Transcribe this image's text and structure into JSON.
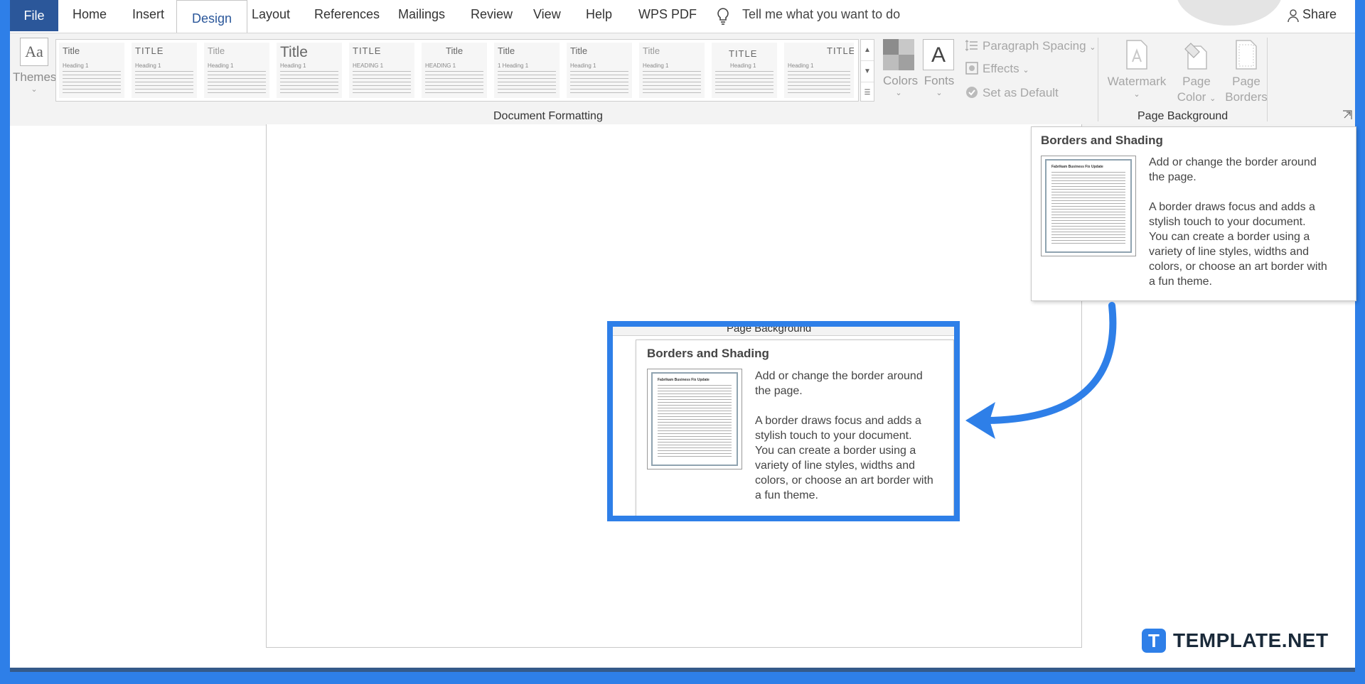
{
  "tabs": {
    "file": "File",
    "home": "Home",
    "insert": "Insert",
    "design": "Design",
    "layout": "Layout",
    "references": "References",
    "mailings": "Mailings",
    "review": "Review",
    "view": "View",
    "help": "Help",
    "wps_pdf": "WPS PDF"
  },
  "tell_me": "Tell me what you want to do",
  "share": "Share",
  "ribbon": {
    "themes_label": "Themes",
    "style_gallery": [
      {
        "title": "Title",
        "heading": "Heading 1"
      },
      {
        "title": "TITLE",
        "heading": "Heading 1"
      },
      {
        "title": "Title",
        "heading": "Heading 1"
      },
      {
        "title": "Title",
        "heading": "Heading 1"
      },
      {
        "title": "TITLE",
        "heading": "HEADING 1"
      },
      {
        "title": "Title",
        "heading": "HEADING 1"
      },
      {
        "title": "Title",
        "heading": "1   Heading 1"
      },
      {
        "title": "Title",
        "heading": "Heading 1"
      },
      {
        "title": "Title",
        "heading": "Heading 1"
      },
      {
        "title": "TITLE",
        "heading": "Heading 1"
      },
      {
        "title": "TITLE",
        "heading": "Heading 1"
      }
    ],
    "colors_label": "Colors",
    "fonts_label": "Fonts",
    "paragraph_spacing": "Paragraph Spacing",
    "effects": "Effects",
    "set_as_default": "Set as Default",
    "document_formatting_group": "Document Formatting",
    "watermark_label": "Watermark",
    "page_color_line1": "Page",
    "page_color_line2": "Color",
    "page_borders_line1": "Page",
    "page_borders_line2": "Borders",
    "page_background_group": "Page Background"
  },
  "tooltip": {
    "title": "Borders and Shading",
    "line1": "Add or change the border around",
    "line2": "the page.",
    "line3": "A border draws focus and adds a",
    "line4": "stylish touch to your document.",
    "line5": "You can create a border using a",
    "line6": "variety of line styles, widths and",
    "line7": "colors, or choose an art border with",
    "line8": "a fun theme.",
    "thumb_heading": "Fabrikam Business Fix Update"
  },
  "callout_group_label": "Page Background",
  "brand": {
    "logo_letter": "T",
    "name": "TEMPLATE.NET"
  },
  "colors": {
    "accent": "#2e7fe8",
    "file_tab": "#2b579a"
  }
}
